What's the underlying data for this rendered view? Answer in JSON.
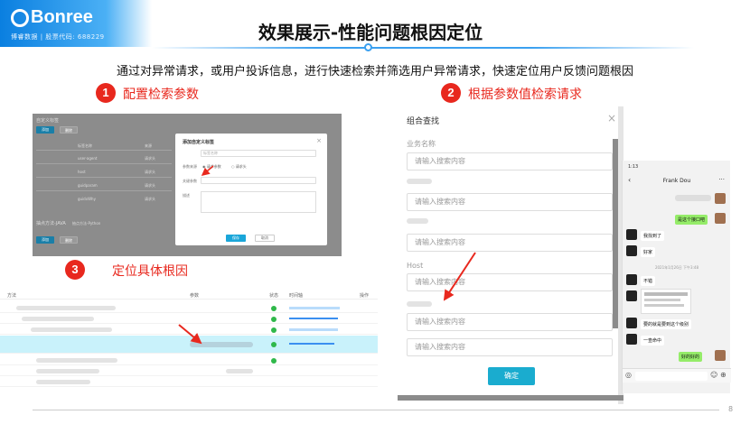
{
  "logo": {
    "brand": "Bonree",
    "sub": "博睿数据 | 股票代码: 688229"
  },
  "title": "效果展示-性能问题根因定位",
  "subtitle": "通过对异常请求，或用户投诉信息，进行快速检索并筛选用户异常请求，快速定位用户反馈问题根因",
  "steps": [
    {
      "num": "1",
      "label": "配置检索参数"
    },
    {
      "num": "2",
      "label": "根据参数值检索请求"
    },
    {
      "num": "3",
      "label": "定位具体根因"
    }
  ],
  "panel1": {
    "heading": "自定义标签",
    "btn_add": "添加",
    "btn_del": "删除",
    "col_name": "标签名称",
    "col_type": "来源",
    "rows": [
      "user-agent",
      "host",
      "guidparam",
      "guidxWhy"
    ],
    "type_val": "请求头",
    "section2": "抽点方法-JAVA",
    "section2_hint": "抽点方法-Python",
    "btn_add2": "添加",
    "btn_del2": "删除",
    "modal": {
      "title": "添加自定义标签",
      "name_label": "标签名称",
      "name_placeholder": "标签名称",
      "source_label": "参数来源",
      "radio1": "请求参数",
      "radio2": "请求头",
      "param_label": "关键参数",
      "desc_label": "描述",
      "ok": "保存",
      "cancel": "取消"
    }
  },
  "panel3": {
    "col_method": "方法",
    "col_param": "参数",
    "col_status": "状态",
    "col_time": "时间轴",
    "col_op": "操作"
  },
  "panel2": {
    "title": "组合查找",
    "label_first": "业务名称",
    "label_host": "Host",
    "placeholder": "请输入搜索内容",
    "ok": "确定"
  },
  "phone": {
    "time": "1:13",
    "contact": "Frank Dou",
    "messages": [
      {
        "side": "right",
        "text": "是这个接口吧"
      },
      {
        "side": "left",
        "text": "我找到了"
      },
      {
        "side": "left",
        "text": "好家"
      },
      {
        "side": "left",
        "text": "不错"
      },
      {
        "side": "left",
        "text": "要的就是要到这个级别"
      },
      {
        "side": "left",
        "text": "一查命中"
      },
      {
        "side": "right",
        "text": "好的好的"
      }
    ],
    "timestamp": "2021年1月26日 下午3:48"
  },
  "page_number": "8"
}
